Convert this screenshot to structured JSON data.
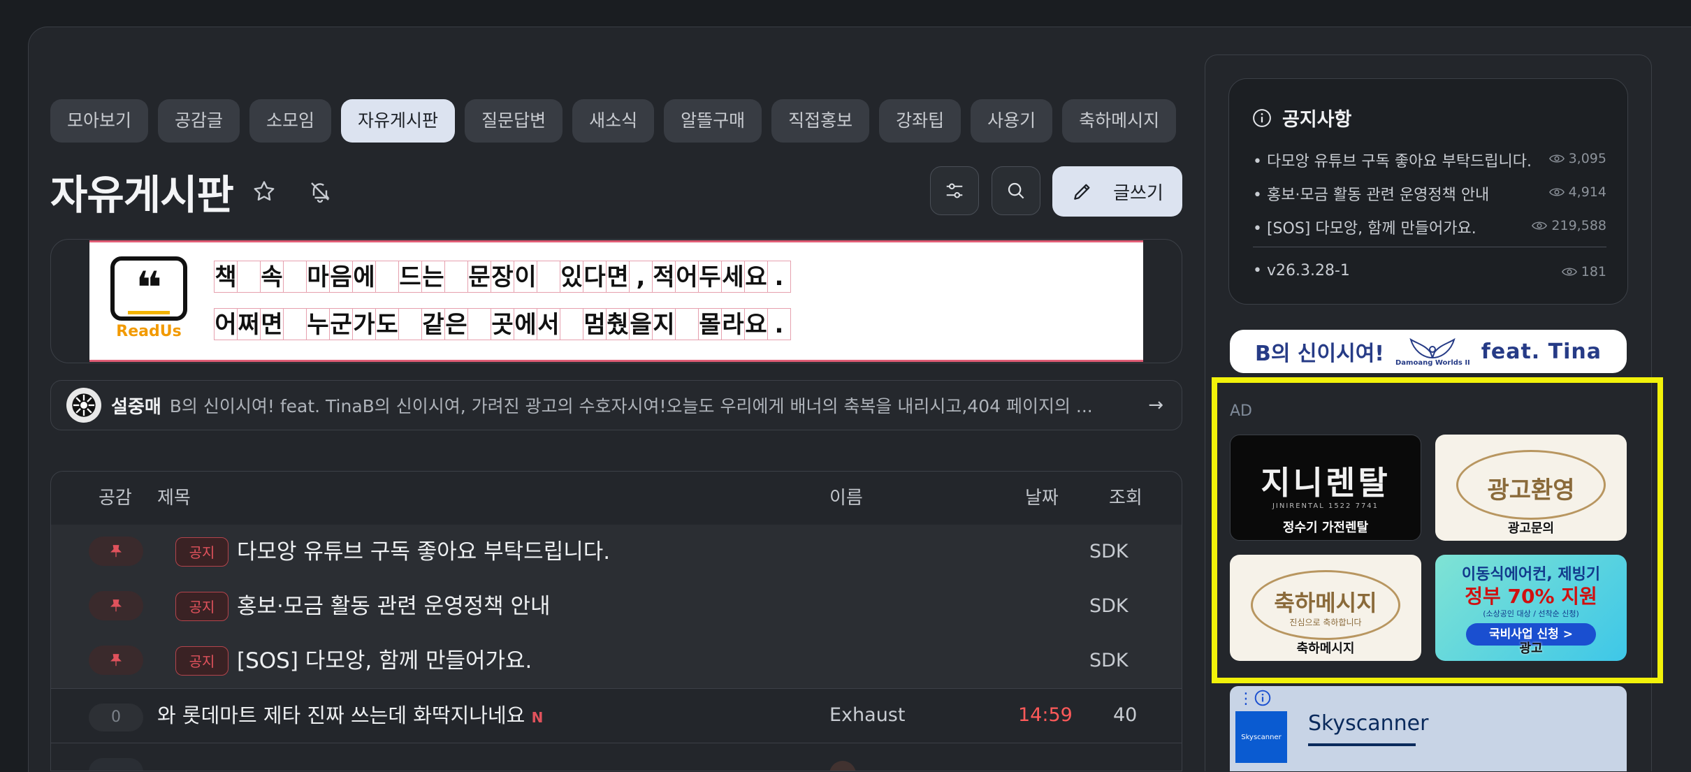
{
  "tabs": [
    "모아보기",
    "공감글",
    "소모임",
    "자유게시판",
    "질문답변",
    "새소식",
    "알뜰구매",
    "직접홍보",
    "강좌팁",
    "사용기",
    "축하메시지"
  ],
  "active_tab_index": 3,
  "page_title": "자유게시판",
  "write_label": "글쓰기",
  "banner": {
    "line1": [
      "책",
      "",
      "속",
      "",
      "마",
      "음",
      "에",
      "",
      "드",
      "는",
      "",
      "문",
      "장",
      "이",
      "",
      "있",
      "다",
      "면",
      ",",
      "적",
      "어",
      "두",
      "세",
      "요",
      "."
    ],
    "line2": [
      "어",
      "쩌",
      "면",
      "",
      "누",
      "군",
      "가",
      "도",
      "",
      "같",
      "은",
      "",
      "곳",
      "에",
      "서",
      "",
      "멈",
      "췄",
      "을",
      "지",
      "",
      "몰",
      "라",
      "요",
      "."
    ],
    "logo_text": "ReadUs"
  },
  "ticker": {
    "name": "설중매",
    "text": "B의 신이시여! feat. TinaB의 신이시여, 가려진 광고의 수호자시여!오늘도 우리에게 배너의 축복을 내리시고,404 페이지의 ...",
    "arrow": "→"
  },
  "table": {
    "headers": {
      "like": "공감",
      "title": "제목",
      "name": "이름",
      "date": "날짜",
      "views": "조회"
    },
    "notice_badge": "공지",
    "notices": [
      {
        "title": "다모앙 유튜브 구독 좋아요 부탁드립니다.",
        "name": "SDK"
      },
      {
        "title": "홍보·모금 활동 관련 운영정책 안내",
        "name": "SDK"
      },
      {
        "title": "[SOS] 다모앙, 함께 만들어가요.",
        "name": "SDK"
      }
    ],
    "rows": [
      {
        "likes": "0",
        "title": "와 롯데마트 제타 진짜 쓰는데 화딱지나네요",
        "new": "N",
        "name": "Exhaust",
        "date": "14:59",
        "views": "40"
      }
    ]
  },
  "notice_box": {
    "title": "공지사항",
    "items": [
      {
        "text": "• 다모앙 유튜브 구독 좋아요 부탁드립니다.",
        "views": "3,095"
      },
      {
        "text": "• 홍보·모금 활동 관련 운영정책 안내",
        "views": "4,914"
      },
      {
        "text": "• [SOS] 다모앙, 함께 만들어가요.",
        "views": "219,588"
      },
      {
        "text": "• v26.3.28-1",
        "views": "181"
      }
    ]
  },
  "tina_banner": {
    "left": "B의 신이시여!",
    "logo": "Damoang Worlds II",
    "right": "feat. Tina"
  },
  "ads": {
    "label": "AD",
    "tiles": [
      {
        "big": "지니렌탈",
        "sub": "JINIRENTAL 1522 7741",
        "caption": "정수기 가전렌탈"
      },
      {
        "big": "광고환영",
        "caption": "광고문의"
      },
      {
        "big": "축하메시지",
        "sub": "진심으로 축하합니다",
        "caption": "축하메시지"
      },
      {
        "big": "이동식에어컨, 제빙기",
        "big2": "정부 70% 지원",
        "sub": "(소상공인 대상 / 선착순 신청)",
        "btn": "국비사업 신청 >",
        "caption": "광고"
      }
    ]
  },
  "skyscanner": {
    "name": "Skyscanner"
  },
  "colors": {
    "accent": "#dce3f0",
    "notice_red": "#e0525c",
    "time_red": "#ff5a5a",
    "highlight": "#f2f20a"
  }
}
